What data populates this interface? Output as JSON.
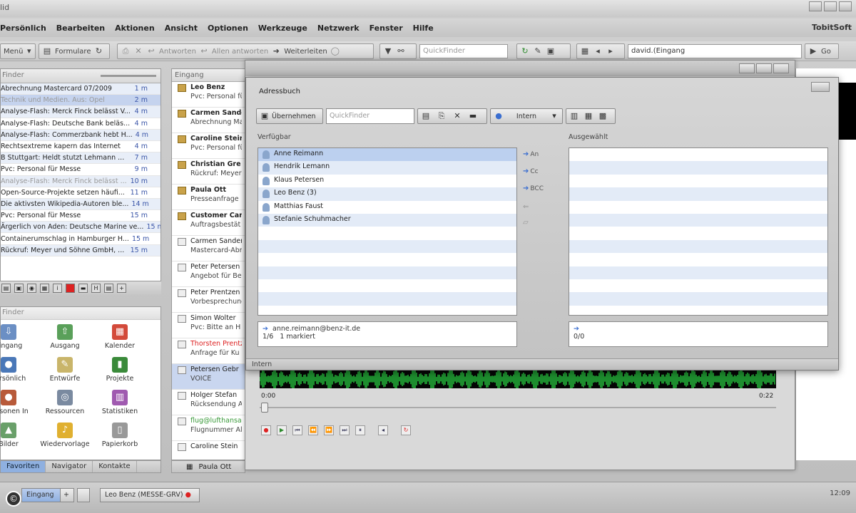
{
  "app": {
    "title_fragment": "lid",
    "brand": "TobitSoft"
  },
  "colors": {
    "accent": "#3a6ed0",
    "selection": "#bcd0ef",
    "wave": "#2ee84a",
    "unread_red": "#d22222"
  },
  "menu": [
    "Persönlich",
    "Bearbeiten",
    "Aktionen",
    "Ansicht",
    "Optionen",
    "Werkzeuge",
    "Netzwerk",
    "Fenster",
    "Hilfe"
  ],
  "toolbar": {
    "menu_label": "Menü",
    "forms_label": "Formulare",
    "reply_label": "Antworten",
    "reply_all_label": "Allen antworten",
    "forward_label": "Weiterleiten",
    "quickfinder_placeholder": "QuickFinder",
    "path_value": "david.(Eingang",
    "go_label": "Go"
  },
  "leftlist": {
    "filter_placeholder": "Finder",
    "rows": [
      {
        "text": "Abrechnung Mastercard 07/2009",
        "time": "1 m"
      },
      {
        "text": "Technik und Medien. Aus: Opel",
        "time": "2 m",
        "faded": true
      },
      {
        "text": "Analyse-Flash: Merck Finck belässt V...",
        "time": "4 m"
      },
      {
        "text": "Analyse-Flash: Deutsche Bank beläs...",
        "time": "4 m"
      },
      {
        "text": "Analyse-Flash: Commerzbank hebt H...",
        "time": "4 m"
      },
      {
        "text": "Rechtsextreme kapern das Internet",
        "time": "4 m"
      },
      {
        "text": "B Stuttgart: Heldt stutzt Lehmann ...",
        "time": "7 m"
      },
      {
        "text": "Pvc: Personal für Messe",
        "time": "9 m"
      },
      {
        "text": "Analyse-Flash: Merck Finck belässt ...",
        "time": "10 m",
        "faded": true
      },
      {
        "text": "Open-Source-Projekte setzen häufi...",
        "time": "11 m"
      },
      {
        "text": "Die aktivsten Wikipedia-Autoren ble...",
        "time": "14 m"
      },
      {
        "text": "Pvc: Personal für Messe",
        "time": "15 m"
      },
      {
        "text": "Ärgerlich von Aden: Deutsche Marine ve...",
        "time": "15 m"
      },
      {
        "text": "Containerumschlag in Hamburger H...",
        "time": "15 m"
      },
      {
        "text": "Rückruf: Meyer und Söhne GmbH, ...",
        "time": "15 m"
      }
    ]
  },
  "launcher": {
    "filter_placeholder": "Finder",
    "tiles": [
      "Eingang",
      "Ausgang",
      "Kalender",
      "Persönlich",
      "Entwürfe",
      "Projekte",
      "Personen In",
      "Ressourcen",
      "Statistiken",
      "Bilder",
      "Wiedervorlage",
      "Papierkorb"
    ],
    "tabs": [
      "Favoriten",
      "Navigator",
      "Kontakte"
    ]
  },
  "midlist": {
    "header": "Eingang",
    "rows": [
      {
        "l1": "Leo Benz",
        "l2": "Pvc: Personal für",
        "bold": true
      },
      {
        "l1": "Carmen Sander",
        "l2": "Abrechnung Mas",
        "bold": true
      },
      {
        "l1": "Caroline Stein",
        "l2": "Pvc: Personal für",
        "bold": true
      },
      {
        "l1": "Christian Gre",
        "l2": "Rückruf: Meyer",
        "bold": true
      },
      {
        "l1": "Paula Ott",
        "l2": "Presseanfrage",
        "bold": true
      },
      {
        "l1": "Customer Care",
        "l2": "Auftragsbestät",
        "bold": true
      },
      {
        "l1": "Carmen Sander",
        "l2": "Mastercard-Abr"
      },
      {
        "l1": "Peter Petersen",
        "l2": "Angebot für Be"
      },
      {
        "l1": "Peter Prentzen",
        "l2": "Vorbesprechung"
      },
      {
        "l1": "Simon Wolter",
        "l2": "Pvc: Bitte an H"
      },
      {
        "l1": "Thorsten Prentz",
        "l2": "Anfrage für Ku",
        "red": true
      },
      {
        "l1": "Petersen Gebr",
        "l2": "VOICE",
        "selected": true
      },
      {
        "l1": "Holger Stefan",
        "l2": "Rücksendung A"
      },
      {
        "l1": "flug@lufthansa",
        "l2": "Flugnummer All",
        "green": true
      },
      {
        "l1": "Caroline Stein",
        "l2": ""
      }
    ],
    "footer": "Paula Ott"
  },
  "player": {
    "time_start": "0:00",
    "time_end": "0:22"
  },
  "dialog": {
    "title": "Adressbuch",
    "take_label": "Übernehmen",
    "quickfinder_placeholder": "QuickFinder",
    "folder_value": "Intern",
    "available_label": "Verfügbar",
    "selected_label": "Ausgewählt",
    "available": [
      {
        "name": "Anne Reimann",
        "selected": true
      },
      {
        "name": "Hendrik Lemann"
      },
      {
        "name": "Klaus Petersen"
      },
      {
        "name": "Leo Benz (3)"
      },
      {
        "name": "Matthias Faust"
      },
      {
        "name": "Stefanie Schuhmacher"
      }
    ],
    "move_to": "An",
    "move_cc": "Cc",
    "move_bcc": "BCC",
    "left_info_email": "anne.reimann@benz-it.de",
    "left_info_count": "1/6",
    "left_info_marked": "1 markiert",
    "right_info_count": "0/0",
    "status": "Intern"
  },
  "taskbar": {
    "inbox_label": "Eingang",
    "message_label": "Leo Benz (MESSE-GRV)",
    "clock": "12:09"
  }
}
